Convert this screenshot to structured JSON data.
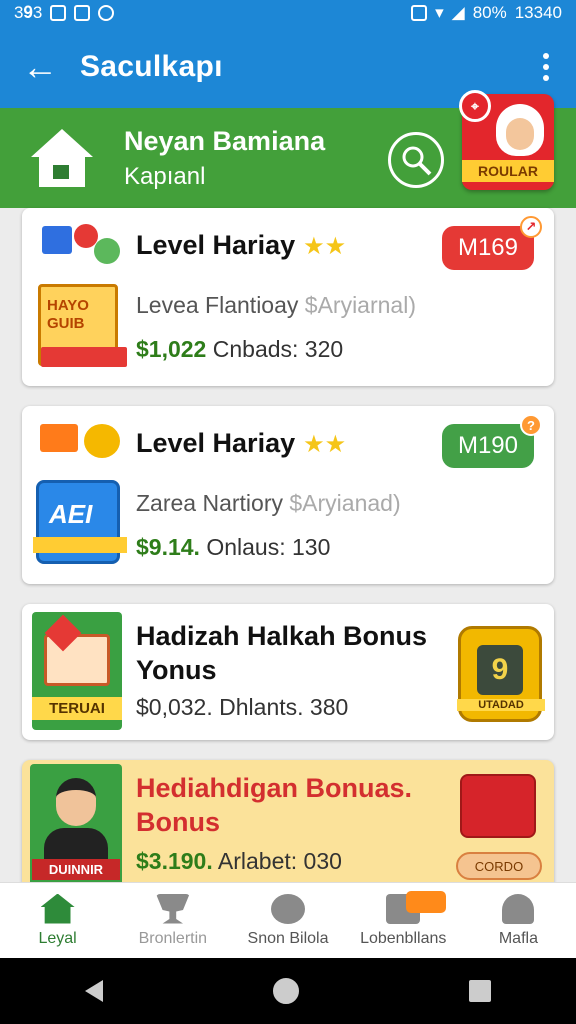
{
  "status": {
    "left": "3𝟗3",
    "right_pct": "80%",
    "time": "13340"
  },
  "app": {
    "title": "Saculkapı"
  },
  "banner": {
    "title": "Neyan Bamiana",
    "subtitle": "Kapıanl",
    "promo_label": "ROULAR"
  },
  "cards": [
    {
      "title": "Level Hariay",
      "stars": "★★",
      "sub": "Levea Flantioay",
      "sub_muted": "$Aryiarnal)",
      "money": "$1,022",
      "line": "Cnbads: 320",
      "pill": "M169",
      "pill_color": "#e53935",
      "thumb_text": "HAYO GUIB"
    },
    {
      "title": "Level Hariay",
      "stars": "★★",
      "sub": "Zarea Nartiory",
      "sub_muted": "$Aryianad)",
      "money": "$9.14.",
      "line": "Onlaus: 130",
      "pill": "M190",
      "pill_color": "#43a047",
      "thumb_text": "AEI"
    },
    {
      "title": "Hadizah Halkah Bonus Yonus",
      "money": "$0,032.",
      "line": "Dhlants. 380",
      "thumb_text": "TERUAI",
      "side_badge": "9",
      "side_label": "UTADAD"
    },
    {
      "title": "Hediahdigan Bonuas. Bonus",
      "money": "$3.190.",
      "line": "Arlabet: 030",
      "thumb_text": "DUINNIR",
      "side_label": "CORDO"
    }
  ],
  "nav": [
    {
      "label": "Leyal"
    },
    {
      "label": "Bronlertin"
    },
    {
      "label": "Snon Bilola"
    },
    {
      "label": "Lobenbllans"
    },
    {
      "label": "Mafla"
    }
  ]
}
